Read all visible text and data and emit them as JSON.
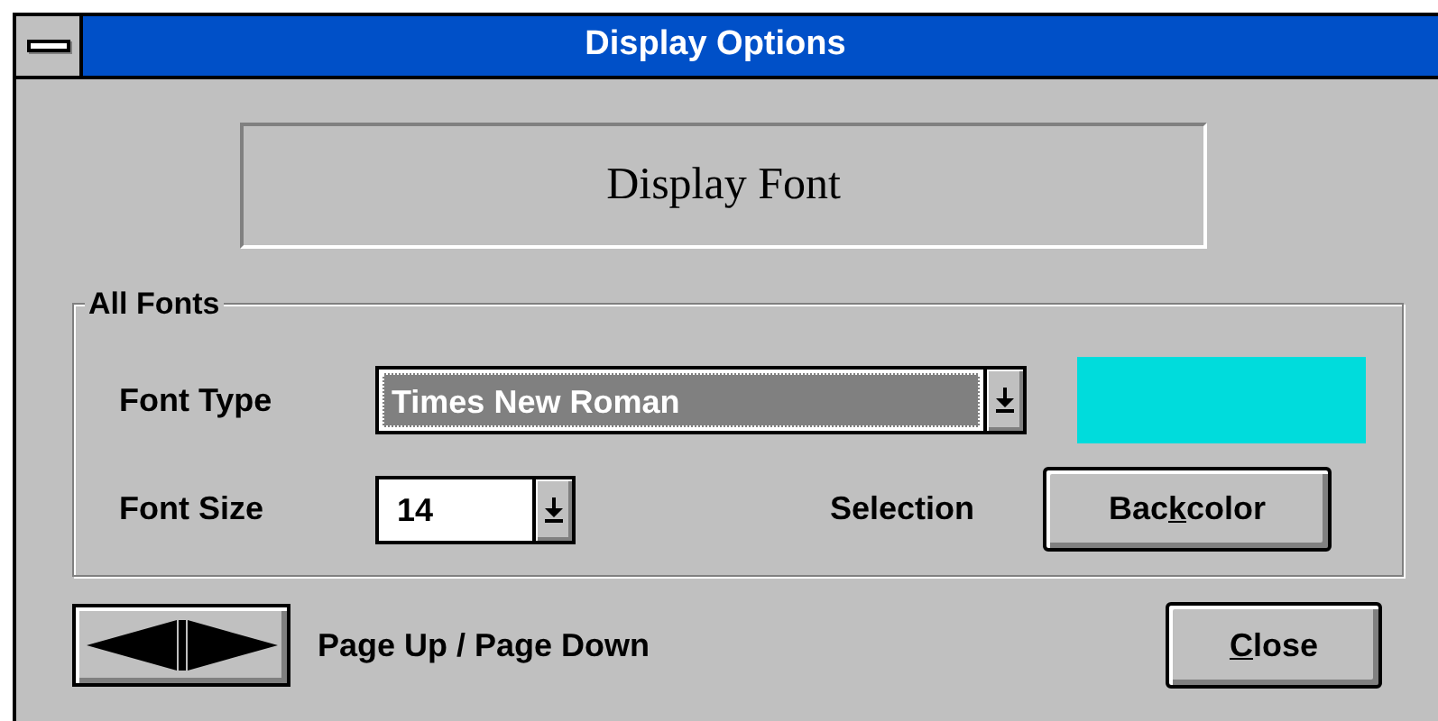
{
  "window": {
    "title": "Display Options"
  },
  "preview": {
    "text": "Display Font"
  },
  "group": {
    "title": "All Fonts",
    "font_type": {
      "label": "Font Type",
      "value": "Times New Roman",
      "selected": true
    },
    "font_size": {
      "label": "Font Size",
      "value": "14",
      "selected": false
    },
    "selection": {
      "label": "Selection",
      "color": "#00dcdc"
    },
    "backcolor_button": {
      "before": "Bac",
      "key": "k",
      "after": "color"
    }
  },
  "paging": {
    "label": "Page Up / Page Down"
  },
  "close_button": {
    "key": "C",
    "after": "lose"
  }
}
